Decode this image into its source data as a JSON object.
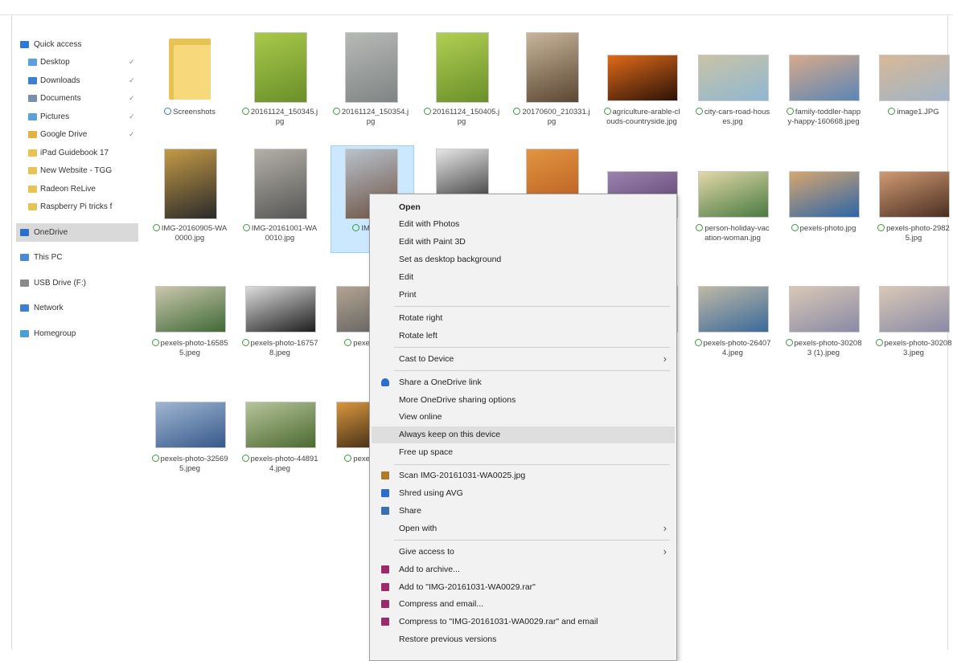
{
  "sidebar": {
    "items": [
      {
        "label": "Quick access",
        "level": "top",
        "icon_color": "#2a7bd6",
        "pinned": false
      },
      {
        "label": "Desktop",
        "level": "child",
        "icon_color": "#5aa0e0",
        "pinned": true
      },
      {
        "label": "Downloads",
        "level": "child",
        "icon_color": "#3d7fd0",
        "pinned": true
      },
      {
        "label": "Documents",
        "level": "child",
        "icon_color": "#7a8fa8",
        "pinned": true
      },
      {
        "label": "Pictures",
        "level": "child",
        "icon_color": "#5aa0e0",
        "pinned": true
      },
      {
        "label": "Google Drive",
        "level": "child",
        "icon_color": "#e3b341",
        "pinned": true
      },
      {
        "label": "iPad Guidebook 17",
        "level": "child",
        "icon_color": "#e8c253",
        "pinned": false
      },
      {
        "label": "New Website - TGG",
        "level": "child",
        "icon_color": "#e8c253",
        "pinned": false
      },
      {
        "label": "Radeon ReLive",
        "level": "child",
        "icon_color": "#e8c253",
        "pinned": false
      },
      {
        "label": "Raspberry Pi tricks f",
        "level": "child",
        "icon_color": "#e8c253",
        "pinned": false
      },
      {
        "label": "OneDrive",
        "level": "top",
        "icon_color": "#2a6fd0",
        "selected": true
      },
      {
        "label": "This PC",
        "level": "top",
        "icon_color": "#4a8ad4"
      },
      {
        "label": "USB Drive (F:)",
        "level": "top",
        "icon_color": "#8a8a8a"
      },
      {
        "label": "Network",
        "level": "top",
        "icon_color": "#3d7fd0"
      },
      {
        "label": "Homegroup",
        "level": "top",
        "icon_color": "#4aa0d8"
      }
    ],
    "pin_glyph": "✓"
  },
  "files": [
    {
      "name": "Screenshots",
      "kind": "folder",
      "sync": "cloud"
    },
    {
      "name": "20161124_150345.jpg",
      "kind": "image",
      "colors": [
        "#6b8f2a",
        "#a8c94a"
      ]
    },
    {
      "name": "20161124_150354.jpg",
      "kind": "image",
      "colors": [
        "#7f8484",
        "#b7b9b6"
      ]
    },
    {
      "name": "20161124_150405.jpg",
      "kind": "image",
      "colors": [
        "#6b8f2a",
        "#b0cf52"
      ]
    },
    {
      "name": "20170600_210331.jpg",
      "kind": "image",
      "colors": [
        "#5a4632",
        "#c9b59a"
      ]
    },
    {
      "name": "agriculture-arable-clouds-countryside.jpg",
      "kind": "image",
      "colors": [
        "#2b1208",
        "#e06a18"
      ]
    },
    {
      "name": "city-cars-road-houses.jpg",
      "kind": "image",
      "colors": [
        "#8fb7d2",
        "#c9c3a6"
      ]
    },
    {
      "name": "family-toddler-happy-happy-160668.jpeg",
      "kind": "image",
      "colors": [
        "#5a86b6",
        "#d8a98a"
      ]
    },
    {
      "name": "image1.JPG",
      "kind": "image",
      "colors": [
        "#a0b4c8",
        "#d8b896"
      ]
    },
    {
      "name": "IMG-20160905-WA0000.jpg",
      "kind": "image",
      "colors": [
        "#2a2a2a",
        "#c49a46"
      ]
    },
    {
      "name": "IMG-20161001-WA0010.jpg",
      "kind": "image",
      "colors": [
        "#565656",
        "#b3b0a6"
      ]
    },
    {
      "name": "IMG-2...",
      "kind": "image",
      "colors": [
        "#6d5142",
        "#b8c2cc"
      ],
      "selected": true
    },
    {
      "name": "",
      "kind": "image",
      "colors": [
        "#141414",
        "#e6e6e6"
      ]
    },
    {
      "name": "",
      "kind": "image",
      "colors": [
        "#b3541e",
        "#e29540"
      ]
    },
    {
      "name": "",
      "kind": "image",
      "colors": [
        "#5a3d6a",
        "#9a83b0"
      ]
    },
    {
      "name": "person-holiday-vacation-woman.jpg",
      "kind": "image",
      "colors": [
        "#4a7a42",
        "#e1d8a8"
      ]
    },
    {
      "name": "pexels-photo.jpg",
      "kind": "image",
      "colors": [
        "#2d66a6",
        "#d6a670"
      ]
    },
    {
      "name": "pexels-photo-29825.jpg",
      "kind": "image",
      "colors": [
        "#4a2f22",
        "#d09a72"
      ]
    },
    {
      "name": "pexels-photo-165855.jpeg",
      "kind": "image",
      "colors": [
        "#3f6a36",
        "#cbc6ad"
      ]
    },
    {
      "name": "pexels-photo-167578.jpeg",
      "kind": "image",
      "colors": [
        "#1e1e1e",
        "#dcdcdc"
      ]
    },
    {
      "name": "pexel...168...",
      "kind": "image",
      "colors": [
        "#5a5a5a",
        "#b3a493"
      ]
    },
    {
      "name": "",
      "kind": "image",
      "colors": [
        "#808080",
        "#c0c0c0"
      ]
    },
    {
      "name": "",
      "kind": "image",
      "colors": [
        "#808080",
        "#c0c0c0"
      ]
    },
    {
      "name": "",
      "kind": "image",
      "colors": [
        "#808080",
        "#c0c0c0"
      ]
    },
    {
      "name": "pexels-photo-264074.jpeg",
      "kind": "image",
      "colors": [
        "#3a6a9a",
        "#bfb8a6"
      ]
    },
    {
      "name": "pexels-photo-302083 (1).jpeg",
      "kind": "image",
      "colors": [
        "#8a8aa6",
        "#d8c8b6"
      ]
    },
    {
      "name": "pexels-photo-302083.jpeg",
      "kind": "image",
      "colors": [
        "#8a8aa6",
        "#d8c8b6"
      ]
    },
    {
      "name": "pexels-photo-325695.jpeg",
      "kind": "image",
      "colors": [
        "#36598a",
        "#9fb6d2"
      ]
    },
    {
      "name": "pexels-photo-448914.jpeg",
      "kind": "image",
      "colors": [
        "#4b6a30",
        "#b7c49a"
      ]
    },
    {
      "name": "pexel...452...",
      "kind": "image",
      "colors": [
        "#2a1c0e",
        "#d8963e"
      ]
    }
  ],
  "context_menu": {
    "items": [
      {
        "label": "Open",
        "bold": true
      },
      {
        "label": "Edit with Photos"
      },
      {
        "label": "Edit with Paint 3D"
      },
      {
        "label": "Set as desktop background"
      },
      {
        "label": "Edit"
      },
      {
        "label": "Print"
      },
      {
        "sep": true
      },
      {
        "label": "Rotate right"
      },
      {
        "label": "Rotate left"
      },
      {
        "sep": true
      },
      {
        "label": "Cast to Device",
        "submenu": true
      },
      {
        "sep": true
      },
      {
        "label": "Share a OneDrive link",
        "icon": "onedrive-icon",
        "icon_color": "#2a6fd0"
      },
      {
        "label": "More OneDrive sharing options"
      },
      {
        "label": "View online"
      },
      {
        "label": "Always keep on this device",
        "highlighted": true
      },
      {
        "label": "Free up space"
      },
      {
        "sep": true
      },
      {
        "label": "Scan IMG-20161031-WA0025.jpg",
        "icon": "scan-icon",
        "icon_color": "#b07a2a"
      },
      {
        "label": "Shred using AVG",
        "icon": "shred-icon",
        "icon_color": "#2a6fd0"
      },
      {
        "label": "Share",
        "icon": "share-icon",
        "icon_color": "#3a6fb0"
      },
      {
        "label": "Open with",
        "submenu": true
      },
      {
        "sep": true
      },
      {
        "label": "Give access to",
        "submenu": true
      },
      {
        "label": "Add to archive...",
        "icon": "archive-icon",
        "icon_color": "#9b2a6a"
      },
      {
        "label": "Add to \"IMG-20161031-WA0029.rar\"",
        "icon": "archive-icon",
        "icon_color": "#9b2a6a"
      },
      {
        "label": "Compress and email...",
        "icon": "archive-icon",
        "icon_color": "#9b2a6a"
      },
      {
        "label": "Compress to \"IMG-20161031-WA0029.rar\" and email",
        "icon": "archive-icon",
        "icon_color": "#9b2a6a"
      },
      {
        "label": "Restore previous versions"
      }
    ],
    "submenu_glyph": "›"
  }
}
